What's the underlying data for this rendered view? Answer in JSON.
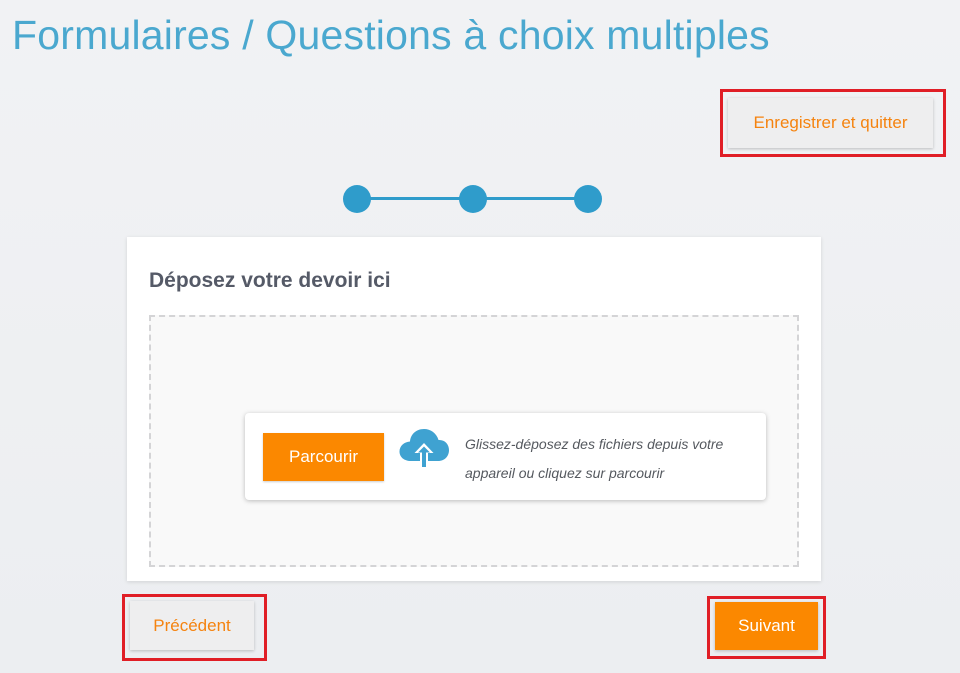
{
  "header": {
    "title": "Formulaires / Questions à choix multiples"
  },
  "actions": {
    "save_quit_label": "Enregistrer et quitter",
    "previous_label": "Précédent",
    "next_label": "Suivant"
  },
  "stepper": {
    "steps": 3
  },
  "upload": {
    "title": "Déposez votre devoir ici",
    "browse_label": "Parcourir",
    "instructions": "Glissez-déposez des fichiers depuis votre appareil ou cliquez sur parcourir",
    "icon": "cloud-upload-icon"
  },
  "colors": {
    "title": "#4aa8cf",
    "accent_orange": "#fb8800",
    "stepper_blue": "#2f9ccb",
    "highlight_red": "#e01e26"
  }
}
